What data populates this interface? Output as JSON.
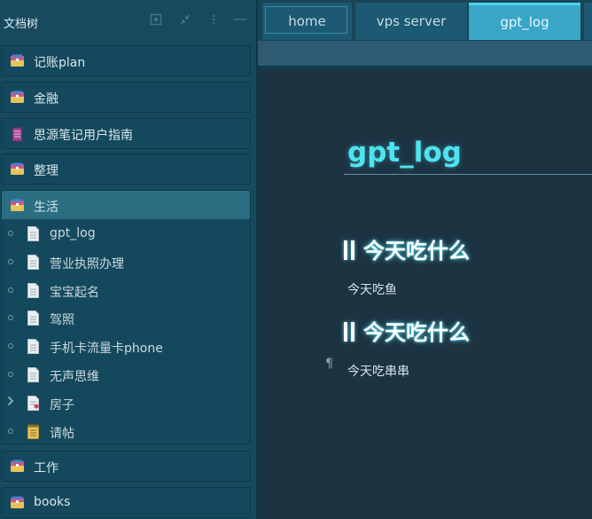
{
  "sidebar": {
    "title": "文档树",
    "header_icons": [
      "focus-icon",
      "collapse-icon",
      "more-icon",
      "minimize-icon"
    ],
    "notebooks": [
      {
        "label": "记账plan",
        "icon": "folder-box-icon"
      },
      {
        "label": "金融",
        "icon": "folder-box-icon"
      },
      {
        "label": "思源笔记用户指南",
        "icon": "book-icon"
      },
      {
        "label": "整理",
        "icon": "folder-box-icon"
      },
      {
        "label": "生活",
        "icon": "folder-box-icon"
      },
      {
        "label": "工作",
        "icon": "folder-box-icon"
      },
      {
        "label": "books",
        "icon": "folder-box-icon"
      }
    ],
    "life_docs": [
      {
        "label": "gpt_log",
        "icon": "document-icon"
      },
      {
        "label": "营业执照办理",
        "icon": "document-icon"
      },
      {
        "label": "宝宝起名",
        "icon": "document-icon"
      },
      {
        "label": "驾照",
        "icon": "document-icon"
      },
      {
        "label": "手机卡流量卡phone",
        "icon": "document-icon"
      },
      {
        "label": "无声思维",
        "icon": "document-icon"
      },
      {
        "label": "房子",
        "icon": "document-pin-icon"
      },
      {
        "label": "请帖",
        "icon": "notepad-icon"
      }
    ]
  },
  "tabs": [
    {
      "label": "home"
    },
    {
      "label": "vps server"
    },
    {
      "label": "gpt_log",
      "active": true
    }
  ],
  "editor": {
    "title": "gpt_log",
    "blocks": [
      {
        "type": "heading",
        "text": "今天吃什么"
      },
      {
        "type": "paragraph",
        "text": "今天吃鱼"
      },
      {
        "type": "heading",
        "text": "今天吃什么"
      },
      {
        "type": "paragraph",
        "text": "今天吃串串"
      }
    ],
    "pilcrow": "¶"
  },
  "colors": {
    "accent": "#4fe3f0",
    "active_tab": "#3aa6c7",
    "sidebar_bg": "#184a5e",
    "editor_bg": "#1c3342"
  }
}
